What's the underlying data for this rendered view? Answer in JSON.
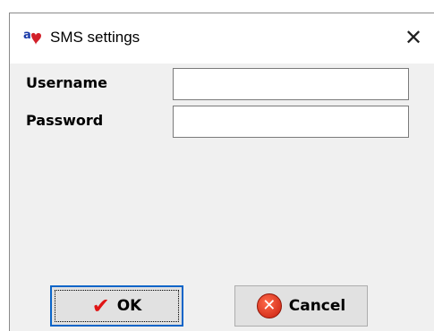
{
  "window": {
    "title": "SMS settings",
    "close_glyph": "✕",
    "icon": "app-ab-icon"
  },
  "form": {
    "username": {
      "label": "Username",
      "value": "",
      "placeholder": ""
    },
    "password": {
      "label": "Password",
      "value": "",
      "placeholder": ""
    }
  },
  "buttons": {
    "ok": {
      "label": "OK",
      "icon": "checkmark-icon",
      "glyph": "✔"
    },
    "cancel": {
      "label": "Cancel",
      "icon": "cancel-icon",
      "glyph": "✕"
    }
  },
  "colors": {
    "dialog_bg": "#f0f0f0",
    "title_bg": "#ffffff",
    "focus_border": "#0a64c8",
    "check_color": "#e01515",
    "cancel_icon_color": "#c81e0e"
  }
}
